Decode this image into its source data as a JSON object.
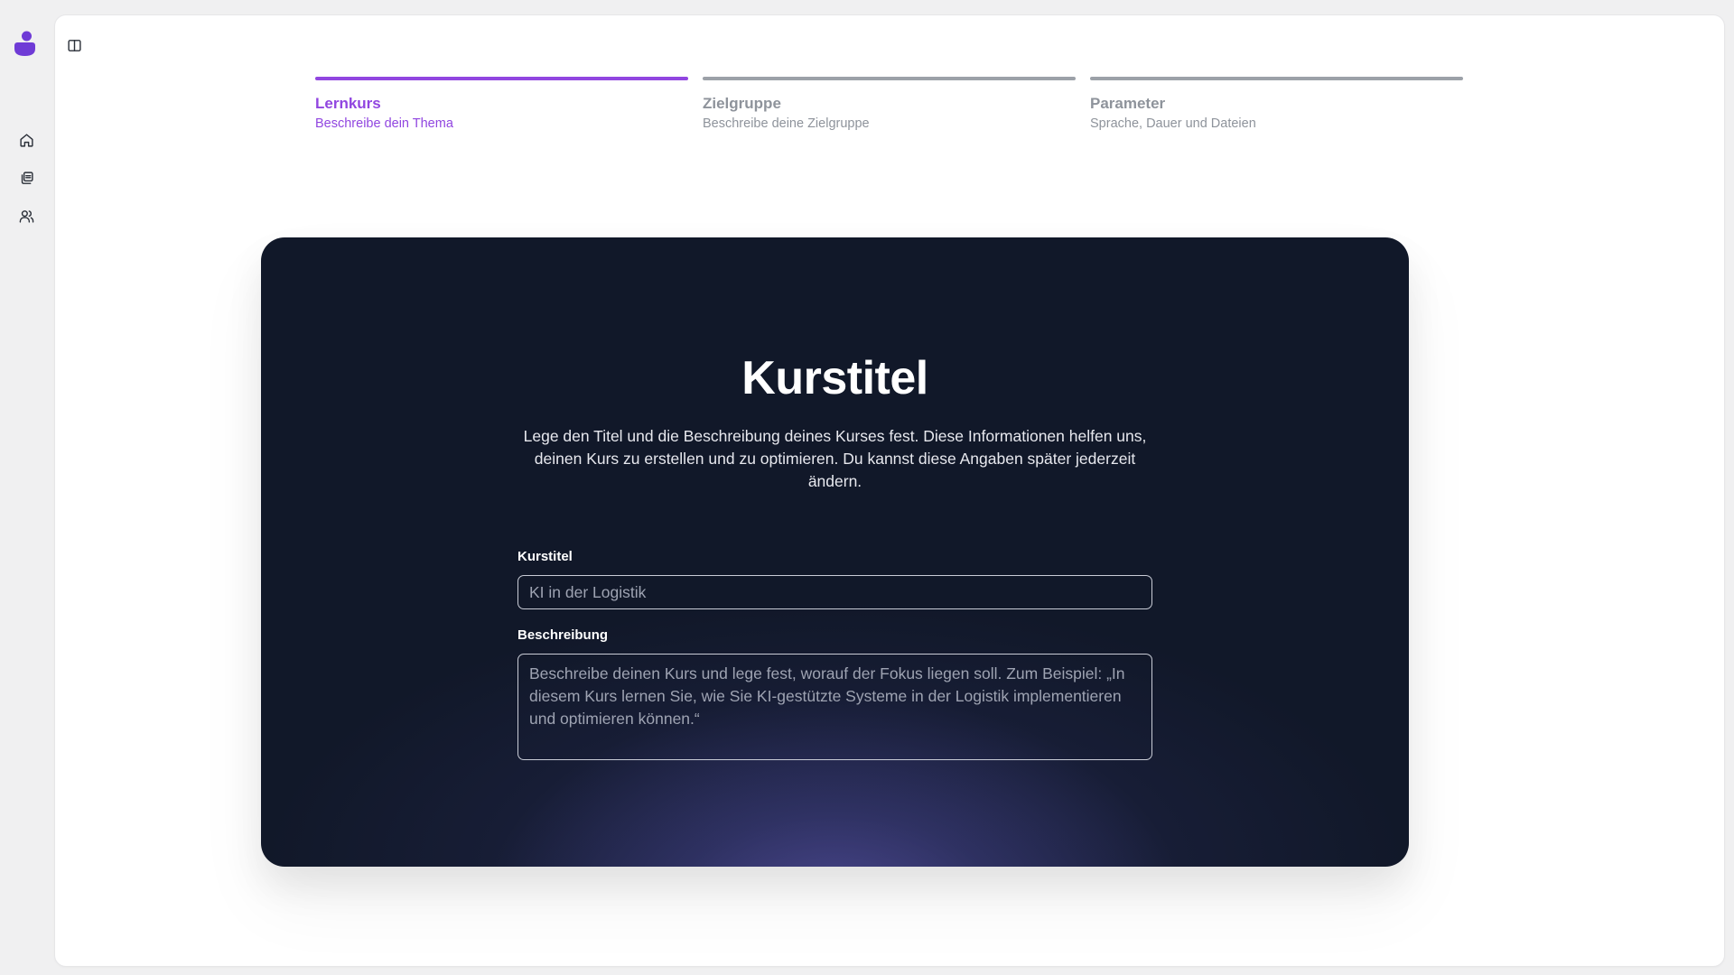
{
  "sidebar": {
    "logo_icon": "blob-logo-icon",
    "items": [
      {
        "icon": "home-icon"
      },
      {
        "icon": "library-icon"
      },
      {
        "icon": "users-icon"
      }
    ]
  },
  "toolbar": {
    "toggle_icon": "sidebar-toggle-icon"
  },
  "stepper": {
    "steps": [
      {
        "title": "Lernkurs",
        "subtitle": "Beschreibe dein Thema",
        "active": true
      },
      {
        "title": "Zielgruppe",
        "subtitle": "Beschreibe deine Zielgruppe",
        "active": false
      },
      {
        "title": "Parameter",
        "subtitle": "Sprache, Dauer und Dateien",
        "active": false
      }
    ]
  },
  "card": {
    "title": "Kurstitel",
    "description": "Lege den Titel und die Beschreibung deines Kurses fest. Diese Informationen helfen uns, deinen Kurs zu erstellen und zu optimieren. Du kannst diese Angaben später jederzeit ändern.",
    "title_field": {
      "label": "Kurstitel",
      "value": "",
      "placeholder": "KI in der Logistik"
    },
    "description_field": {
      "label": "Beschreibung",
      "value": "",
      "placeholder": "Beschreibe deinen Kurs und lege fest, worauf der Fokus liegen soll. Zum Beispiel: „In diesem Kurs lernen Sie, wie Sie KI-gestützte Systeme in der Logistik implementieren und optimieren können.“"
    }
  },
  "colors": {
    "accent": "#9146e0",
    "inactive": "#9ca1a8",
    "card_bg": "#111829",
    "logo": "#6f3bd6"
  }
}
